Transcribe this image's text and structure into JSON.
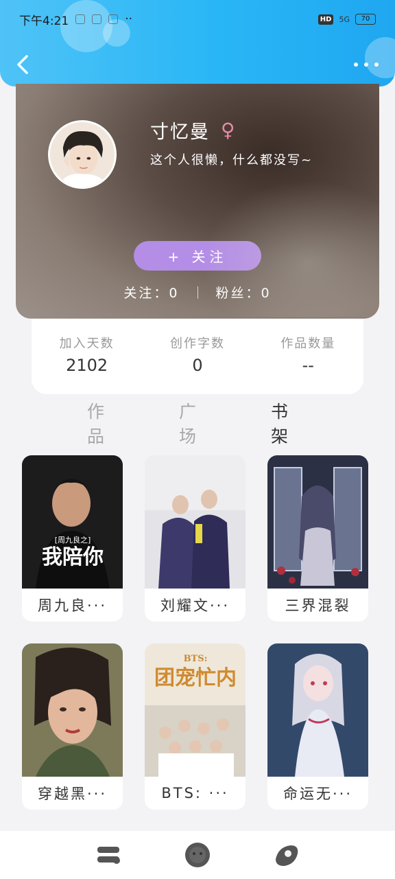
{
  "status_bar": {
    "time": "下午4:21",
    "dots": "··",
    "hd": "HD",
    "signal": "5G",
    "battery": "70"
  },
  "header": {
    "back_icon": "chevron-left-icon",
    "more_icon": "more-dots-icon"
  },
  "profile": {
    "name": "寸忆曼",
    "gender_symbol": "♀",
    "bio": "这个人很懒，什么都没写~",
    "follow_label": "+  关注",
    "following_label": "关注：0",
    "fans_label": "粉丝：0"
  },
  "stats": [
    {
      "label": "加入天数",
      "value": "2102"
    },
    {
      "label": "创作字数",
      "value": "0"
    },
    {
      "label": "作品数量",
      "value": "--"
    }
  ],
  "tabs": [
    {
      "label": "作品",
      "active": false
    },
    {
      "label": "广场",
      "active": false
    },
    {
      "label": "书架",
      "active": true
    }
  ],
  "books": [
    {
      "title": "周九良···",
      "cover_text": "我陪你",
      "cover_sub": "[周九良之]"
    },
    {
      "title": "刘耀文···",
      "cover_text": "",
      "cover_sub": ""
    },
    {
      "title": "三界混裂",
      "cover_text": "",
      "cover_sub": ""
    },
    {
      "title": "穿越黑···",
      "cover_text": "",
      "cover_sub": ""
    },
    {
      "title": "BTS: ···",
      "cover_text": "团宠忙内",
      "cover_sub": "BTS:"
    },
    {
      "title": "命运无···",
      "cover_text": "",
      "cover_sub": ""
    }
  ],
  "bottom_nav": [
    {
      "icon": "bookshelf-icon"
    },
    {
      "icon": "home-icon"
    },
    {
      "icon": "profile-icon"
    }
  ],
  "colors": {
    "accent": "#b48de6",
    "header": "#29b6f6",
    "gender": "#e88aa8"
  }
}
